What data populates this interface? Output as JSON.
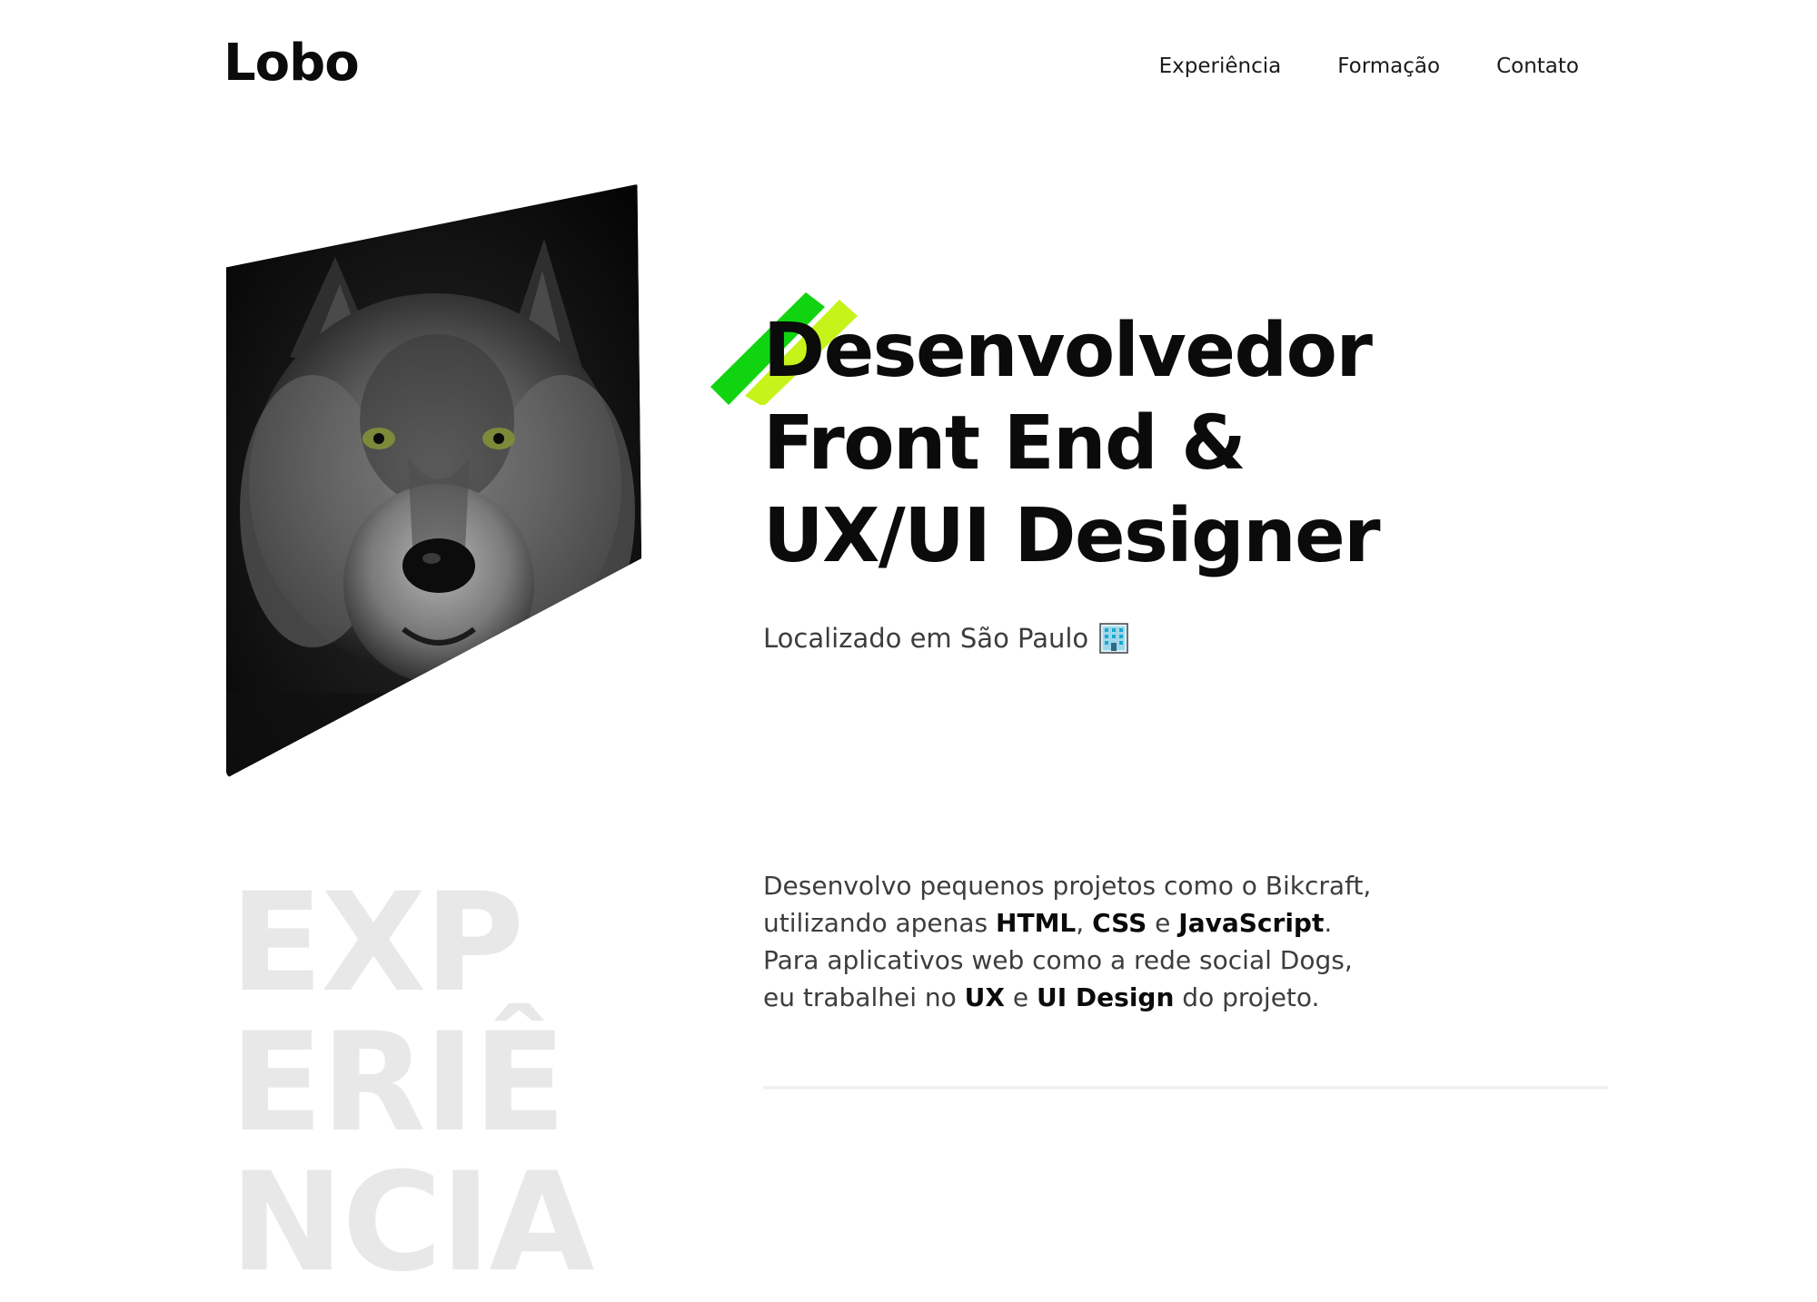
{
  "header": {
    "logo": "Lobo",
    "nav": [
      {
        "label": "Experiência"
      },
      {
        "label": "Formação"
      },
      {
        "label": "Contato"
      }
    ]
  },
  "hero": {
    "image_icon": "wolf-photo",
    "title_lines": [
      "Desenvolvedor",
      "Front End &",
      "UX/UI Designer"
    ],
    "location": "Localizado em São Paulo",
    "location_icon": "building-icon",
    "accent_colors": [
      "#11d411",
      "#c6f31a"
    ]
  },
  "experience": {
    "section_title": "EXPERIÊNCIA",
    "paragraph_parts": {
      "p1": "Desenvolvo pequenos projetos como o Bikcraft, utilizando apenas ",
      "html": "HTML",
      "p2": ", ",
      "css": "CSS",
      "p3": " e ",
      "js": "JavaScript",
      "p4": ". Para aplicativos web como a rede social Dogs, eu trabalhei no ",
      "ux": "UX",
      "p5": " e ",
      "uidesign": "UI Design",
      "p6": " do projeto."
    }
  }
}
